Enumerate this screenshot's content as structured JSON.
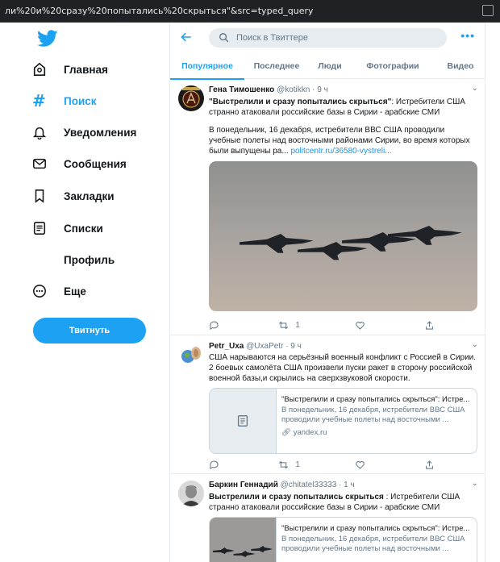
{
  "browser": {
    "url": "ли%20и%20сразу%20попытались%20скрыться\"&src=typed_query"
  },
  "nav": {
    "logo_icon": "twitter-bird-icon",
    "items": [
      {
        "label": "Главная",
        "icon": "home-icon"
      },
      {
        "label": "Поиск",
        "icon": "hashtag-icon",
        "active": true
      },
      {
        "label": "Уведомления",
        "icon": "bell-icon"
      },
      {
        "label": "Сообщения",
        "icon": "mail-icon"
      },
      {
        "label": "Закладки",
        "icon": "bookmark-icon"
      },
      {
        "label": "Списки",
        "icon": "list-icon"
      },
      {
        "label": "Профиль",
        "icon": "profile-icon"
      },
      {
        "label": "Еще",
        "icon": "more-circle-icon"
      }
    ],
    "tweet_button": "Твитнуть"
  },
  "header": {
    "search_placeholder": "Поиск в Твиттере",
    "tabs": [
      "Популярное",
      "Последнее",
      "Люди",
      "Фотографии",
      "Видео"
    ],
    "active_tab": 0
  },
  "tweets": [
    {
      "name": "Гена Тимошенко",
      "meta": "@kotikkn · 9 ч",
      "title": "\"Выстрелили и сразу попытались скрыться\"",
      "text1": ": Истребители США странно атаковали российские базы в Сирии - арабские СМИ",
      "text2": "В понедельник, 16 декабря, истребители ВВС США проводили учебные полеты над восточными районами Сирии, во время которых были выпущены ра...",
      "link": "politcentr.ru/36580-vystreli...",
      "retweets": "1",
      "likes": ""
    },
    {
      "name": "Petr_Uxa",
      "meta": "@UxaPetr · 9 ч",
      "text": "США нарываются на серьёзный военный конфликт с Россией в Сирии. 2 боевых самолёта США произвели пуски ракет в сторону российской военной базы,и скрылись на сверхзвуковой скорости.",
      "card": {
        "title": "\"Выстрелили и сразу попытались скрыться\": Истре...",
        "desc": "В понедельник, 16 декабря, истребители ВВС США проводили учебные полеты над восточными ...",
        "domain": "yandex.ru"
      },
      "retweets": "1"
    },
    {
      "name": "Баркин Геннадий",
      "meta": "@chitatel33333 · 1 ч",
      "title": "Выстрелили и сразу попытались скрыться",
      "text1": " : Истребители США странно атаковали российские базы в Сирии - арабские СМИ",
      "card": {
        "title": "\"Выстрелили и сразу попытались скрыться\": Истре...",
        "desc": "В понедельник, 16 декабря, истребители ВВС США проводили учебные полеты над восточными ..."
      }
    }
  ],
  "colors": {
    "accent": "#1da1f2",
    "text": "#14171a",
    "muted": "#657786",
    "border": "#e6ecf0"
  }
}
